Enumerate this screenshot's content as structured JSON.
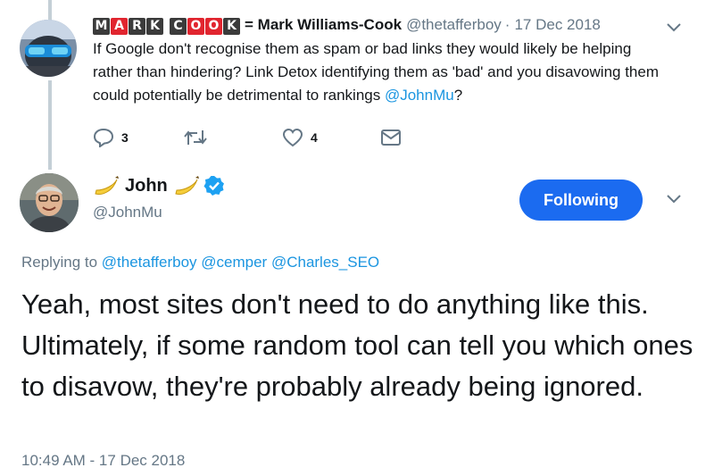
{
  "parent_tweet": {
    "display_name_logo": {
      "word1": [
        "M",
        "A",
        "R",
        "K"
      ],
      "word2": [
        "C",
        "O",
        "O",
        "K"
      ],
      "word1_colors": [
        "dark",
        "red",
        "dark",
        "dark"
      ],
      "word2_colors": [
        "dark",
        "red",
        "red",
        "dark"
      ]
    },
    "name_prefix": "=",
    "name": "Mark Williams-Cook",
    "handle": "@thetafferboy",
    "separator": "·",
    "date": "17 Dec 2018",
    "text": "If Google don't recognise them as spam or bad links they would likely be helping rather than hindering? Link Detox identifying them as 'bad' and you disavowing them could potentially be detrimental to rankings ",
    "text_mention": "@JohnMu",
    "text_suffix": "?",
    "reply_count": "3",
    "like_count": "4"
  },
  "main_tweet": {
    "name": "John",
    "handle": "@JohnMu",
    "follow_label": "Following",
    "replying_prefix": "Replying to",
    "replying_to": [
      "@thetafferboy",
      "@cemper",
      "@Charles_SEO"
    ],
    "text": "Yeah, most sites don't need to do anything like this. Ultimately, if some random tool can tell you which ones to disavow, they're probably already being ignored.",
    "timestamp": "10:49 AM - 17 Dec 2018"
  },
  "colors": {
    "link": "#1b95e0",
    "follow_button": "#1b6bf0",
    "verified_badge": "#1da1f2",
    "secondary_text": "#657786",
    "logo_red": "#e1252f",
    "logo_dark": "#3b3b3b"
  },
  "icons": [
    "reply-icon",
    "retweet-icon",
    "like-icon",
    "dm-icon",
    "verified-icon",
    "banana-icon",
    "chevron-down-icon"
  ]
}
